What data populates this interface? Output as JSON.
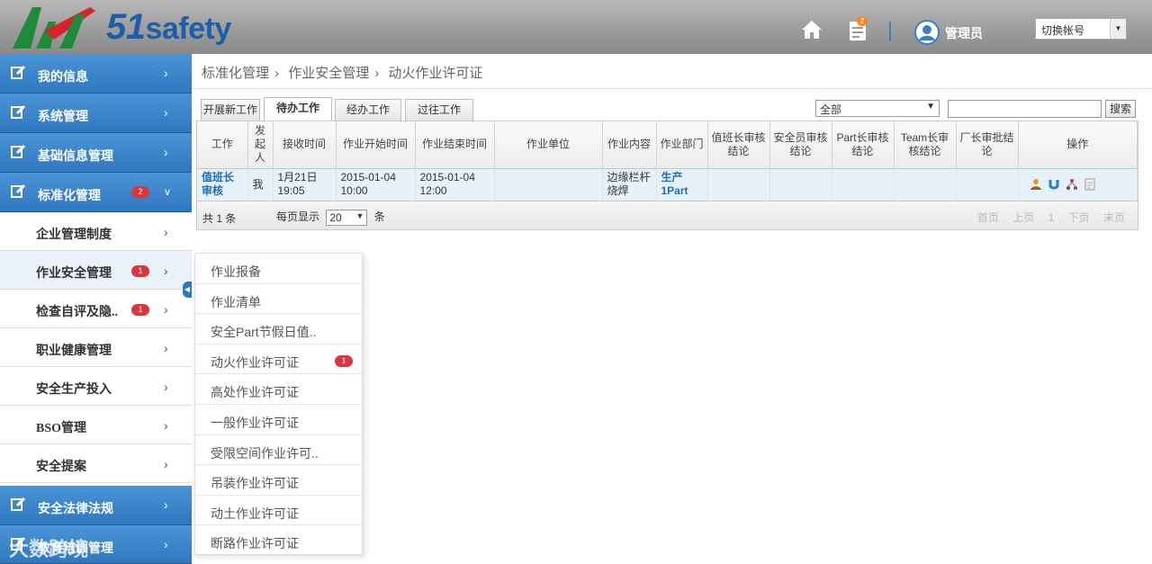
{
  "header": {
    "brand_number": "51",
    "brand_text": "safety",
    "user_label": "管理员",
    "notification_count": "2",
    "switch_account": "切换帐号"
  },
  "sidebar": {
    "items": [
      {
        "label": "我的信息"
      },
      {
        "label": "系统管理"
      },
      {
        "label": "基础信息管理"
      },
      {
        "label": "标准化管理",
        "badge": "2"
      }
    ],
    "sub_items": [
      {
        "label": "企业管理制度"
      },
      {
        "label": "作业安全管理",
        "badge": "1"
      },
      {
        "label": "检查自评及隐..",
        "badge": "1"
      },
      {
        "label": "职业健康管理"
      },
      {
        "label": "安全生产投入"
      },
      {
        "label": "BSO管理"
      },
      {
        "label": "安全提案"
      }
    ],
    "bottom_items": [
      {
        "label": "安全法律法规"
      },
      {
        "label": "教育培训管理"
      }
    ]
  },
  "breadcrumb": [
    "标准化管理",
    "作业安全管理",
    "动火作业许可证"
  ],
  "tabs": [
    "开展新工作",
    "待办工作",
    "经办工作",
    "过往工作"
  ],
  "filter": {
    "selected": "全部"
  },
  "search": {
    "button": "搜索"
  },
  "table": {
    "headers": [
      "工作",
      "发起人",
      "接收时间",
      "作业开始时间",
      "作业结束时间",
      "作业单位",
      "作业内容",
      "作业部门",
      "值班长审核结论",
      "安全员审核结论",
      "Part长审核结论",
      "Team长审核结论",
      "厂长审批结论",
      "操作"
    ],
    "rows": [
      {
        "work": "值班长审核",
        "initiator": "我",
        "received": "1月21日 19:05",
        "start": "2015-01-04 10:00",
        "end": "2015-01-04 12:00",
        "unit": "",
        "content": "边缘栏杆烧焊",
        "dept": "生产1Part"
      }
    ],
    "footer": {
      "total": "共 1 条",
      "per_page_label": "每页显示",
      "per_page_value": "20",
      "per_page_unit": "条",
      "pager": [
        "首页",
        "上页",
        "1",
        "下页",
        "末页"
      ]
    }
  },
  "flyout": [
    {
      "label": "作业报备"
    },
    {
      "label": "作业清单"
    },
    {
      "label": "安全Part节假日值.."
    },
    {
      "label": "动火作业许可证",
      "badge": "1"
    },
    {
      "label": "高处作业许可证"
    },
    {
      "label": "一般作业许可证"
    },
    {
      "label": "受限空间作业许可.."
    },
    {
      "label": "吊装作业许可证"
    },
    {
      "label": "动土作业许可证"
    },
    {
      "label": "断路作业许可证"
    }
  ],
  "watermark": "大数跨境"
}
